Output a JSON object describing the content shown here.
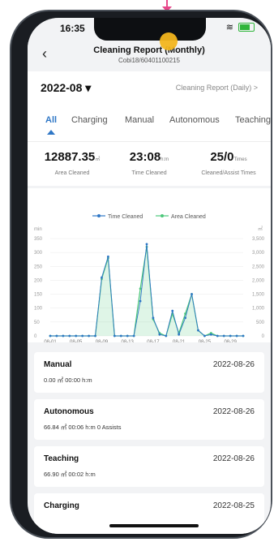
{
  "status_bar": {
    "time": "16:35"
  },
  "header": {
    "title": "Cleaning Report (Monthly)",
    "subtitle": "Cobi18/60401100215",
    "back_icon": "chevron-left-icon"
  },
  "period": {
    "month": "2022-08 ▾",
    "daily_link": "Cleaning Report (Daily) >"
  },
  "tabs": [
    {
      "label": "All",
      "active": true
    },
    {
      "label": "Charging"
    },
    {
      "label": "Manual"
    },
    {
      "label": "Autonomous"
    },
    {
      "label": "Teaching"
    }
  ],
  "stats": [
    {
      "value": "12887.35",
      "unit": "㎡",
      "label": "Area Cleaned"
    },
    {
      "value": "23:08",
      "unit": "h:m",
      "label": "Time Cleaned"
    },
    {
      "value": "25/0",
      "unit": "Times",
      "label": "Cleaned/Assist Times"
    }
  ],
  "chart_data": {
    "type": "line",
    "left_axis_label": "min",
    "right_axis_label": "㎡",
    "left_ticks": [
      "0",
      "50",
      "100",
      "150",
      "200",
      "250",
      "300",
      "350"
    ],
    "right_ticks": [
      "0",
      "500",
      "1,000",
      "1,500",
      "2,000",
      "2,500",
      "3,000",
      "3,500"
    ],
    "x_tick_labels": [
      "08-01",
      "08-05",
      "08-09",
      "08-13",
      "08-17",
      "08-21",
      "08-25",
      "08-29"
    ],
    "ylim_left": [
      0,
      350
    ],
    "ylim_right": [
      0,
      3500
    ],
    "series": [
      {
        "name": "Time Cleaned",
        "color": "#2f77c6",
        "x": [
          1,
          2,
          3,
          4,
          5,
          6,
          7,
          8,
          9,
          10,
          11,
          12,
          13,
          14,
          15,
          16,
          17,
          18,
          19,
          20,
          21,
          22,
          23,
          24,
          25,
          26,
          27,
          28,
          29,
          30,
          31
        ],
        "values": [
          0,
          0,
          0,
          0,
          0,
          0,
          0,
          0,
          210,
          285,
          0,
          0,
          0,
          0,
          125,
          330,
          65,
          5,
          0,
          90,
          5,
          65,
          150,
          20,
          0,
          5,
          0,
          0,
          0,
          0,
          0
        ]
      },
      {
        "name": "Area Cleaned",
        "color": "#4cc77a",
        "x": [
          1,
          2,
          3,
          4,
          5,
          6,
          7,
          8,
          9,
          10,
          11,
          12,
          13,
          14,
          15,
          16,
          17,
          18,
          19,
          20,
          21,
          22,
          23,
          24,
          25,
          26,
          27,
          28,
          29,
          30,
          31
        ],
        "values": [
          0,
          0,
          0,
          0,
          0,
          0,
          0,
          0,
          2050,
          2800,
          0,
          0,
          0,
          0,
          1700,
          3200,
          600,
          100,
          0,
          800,
          100,
          800,
          1500,
          200,
          0,
          100,
          0,
          0,
          0,
          0,
          0
        ]
      }
    ]
  },
  "records": [
    {
      "name": "Manual",
      "date": "2022-08-26",
      "detail": "0.00 ㎡  00:00 h:m"
    },
    {
      "name": "Autonomous",
      "date": "2022-08-26",
      "detail": "66.84 ㎡  00:06 h:m  0 Assists"
    },
    {
      "name": "Teaching",
      "date": "2022-08-26",
      "detail": "66.90 ㎡  00:02 h:m"
    },
    {
      "name": "Charging",
      "date": "2022-08-25",
      "detail": ""
    }
  ]
}
